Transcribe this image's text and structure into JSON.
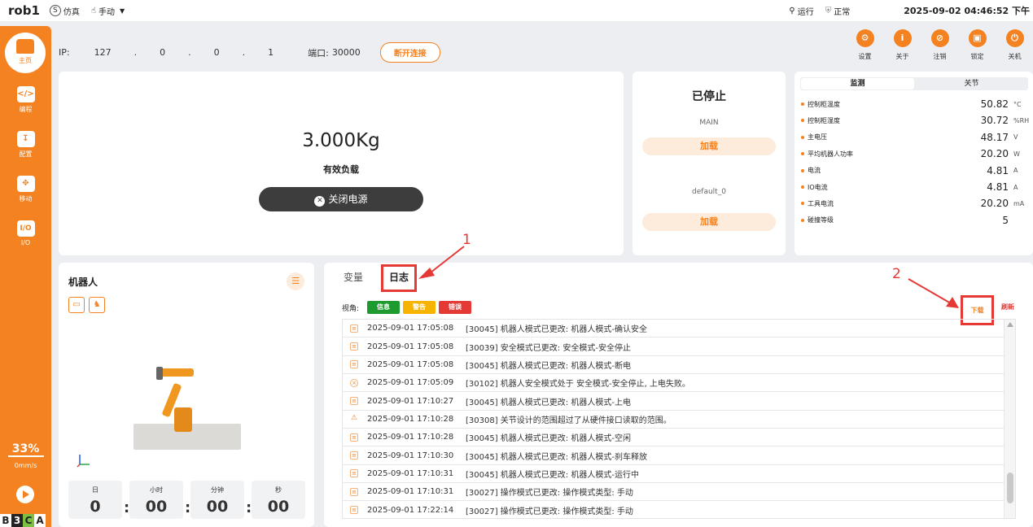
{
  "topbar": {
    "robot_name": "rob1",
    "sim_label": "仿真",
    "manual_label": "手动",
    "run_label": "运行",
    "normal_label": "正常",
    "datetime": "2025-09-02 04:46:52 下午"
  },
  "sidebar": {
    "home_label": "主页",
    "items": [
      {
        "label": "编程",
        "icon": "</>"
      },
      {
        "label": "配置",
        "icon": "↧"
      },
      {
        "label": "移动",
        "icon": "✥"
      },
      {
        "label": "I/O",
        "icon": "I/O"
      }
    ],
    "speed_pct": "33%",
    "speed_unit": "0mm/s",
    "bca": [
      "B",
      "3",
      "C",
      "A"
    ]
  },
  "connection": {
    "ip_label": "IP:",
    "ip": [
      "127",
      ".",
      "0",
      ".",
      "0",
      ".",
      "1"
    ],
    "port_label": "端口:",
    "port": "30000",
    "disconnect_label": "断开连接"
  },
  "tools": [
    {
      "label": "设置",
      "icon": "gear-icon"
    },
    {
      "label": "关于",
      "icon": "info-icon"
    },
    {
      "label": "注销",
      "icon": "logout-icon"
    },
    {
      "label": "锁定",
      "icon": "lock-icon"
    },
    {
      "label": "关机",
      "icon": "power-icon"
    }
  ],
  "payload": {
    "value": "3.000Kg",
    "label": "有效负载",
    "power_off_label": "关闭电源"
  },
  "status": {
    "state": "已停止",
    "program1": "MAIN",
    "load1": "加载",
    "program2": "default_0",
    "load2": "加载"
  },
  "monitor": {
    "tabs": [
      "监测",
      "关节"
    ],
    "rows": [
      {
        "name": "控制柜温度",
        "value": "50.82",
        "unit": "°C"
      },
      {
        "name": "控制柜湿度",
        "value": "30.72",
        "unit": "%RH"
      },
      {
        "name": "主电压",
        "value": "48.17",
        "unit": "V"
      },
      {
        "name": "平均机器人功率",
        "value": "20.20",
        "unit": "W"
      },
      {
        "name": "电流",
        "value": "4.81",
        "unit": "A"
      },
      {
        "name": "IO电流",
        "value": "4.81",
        "unit": "A"
      },
      {
        "name": "工具电流",
        "value": "20.20",
        "unit": "mA"
      },
      {
        "name": "碰撞等级",
        "value": "5",
        "unit": ""
      }
    ]
  },
  "robot": {
    "title": "机器人",
    "timer": {
      "labels": [
        "日",
        "小时",
        "分钟",
        "秒"
      ],
      "values": [
        "0",
        "00",
        "00",
        "00"
      ]
    }
  },
  "log": {
    "tabs": [
      "变量",
      "日志"
    ],
    "annotation_1": "1",
    "annotation_2": "2",
    "filter_label": "视角:",
    "chips": [
      {
        "label": "信息",
        "color": "#1e9b2e"
      },
      {
        "label": "警告",
        "color": "#f6b400"
      },
      {
        "label": "错误",
        "color": "#e53935"
      }
    ],
    "download_label": "下载",
    "refresh_label": "刷新",
    "entries": [
      {
        "type": "info",
        "time": "2025-09-01 17:05:08",
        "msg": "[30045] 机器人模式已更改: 机器人模式-确认安全"
      },
      {
        "type": "info",
        "time": "2025-09-01 17:05:08",
        "msg": "[30039] 安全模式已更改: 安全模式-安全停止"
      },
      {
        "type": "info",
        "time": "2025-09-01 17:05:08",
        "msg": "[30045] 机器人模式已更改: 机器人模式-断电"
      },
      {
        "type": "error",
        "time": "2025-09-01 17:05:09",
        "msg": "[30102] 机器人安全模式处于 安全模式-安全停止, 上电失败。"
      },
      {
        "type": "info",
        "time": "2025-09-01 17:10:27",
        "msg": "[30045] 机器人模式已更改: 机器人模式-上电"
      },
      {
        "type": "warn",
        "time": "2025-09-01 17:10:28",
        "msg": "[30308] 关节设计的范围超过了从硬件接口读取的范围。"
      },
      {
        "type": "info",
        "time": "2025-09-01 17:10:28",
        "msg": "[30045] 机器人模式已更改: 机器人模式-空闲"
      },
      {
        "type": "info",
        "time": "2025-09-01 17:10:30",
        "msg": "[30045] 机器人模式已更改: 机器人模式-刹车释放"
      },
      {
        "type": "info",
        "time": "2025-09-01 17:10:31",
        "msg": "[30045] 机器人模式已更改: 机器人模式-运行中"
      },
      {
        "type": "info",
        "time": "2025-09-01 17:10:31",
        "msg": "[30027] 操作模式已更改: 操作模式类型: 手动"
      },
      {
        "type": "info",
        "time": "2025-09-01 17:22:14",
        "msg": "[30027] 操作模式已更改: 操作模式类型: 手动"
      }
    ]
  },
  "colors": {
    "accent": "#f58220",
    "annotation": "#e53935"
  }
}
